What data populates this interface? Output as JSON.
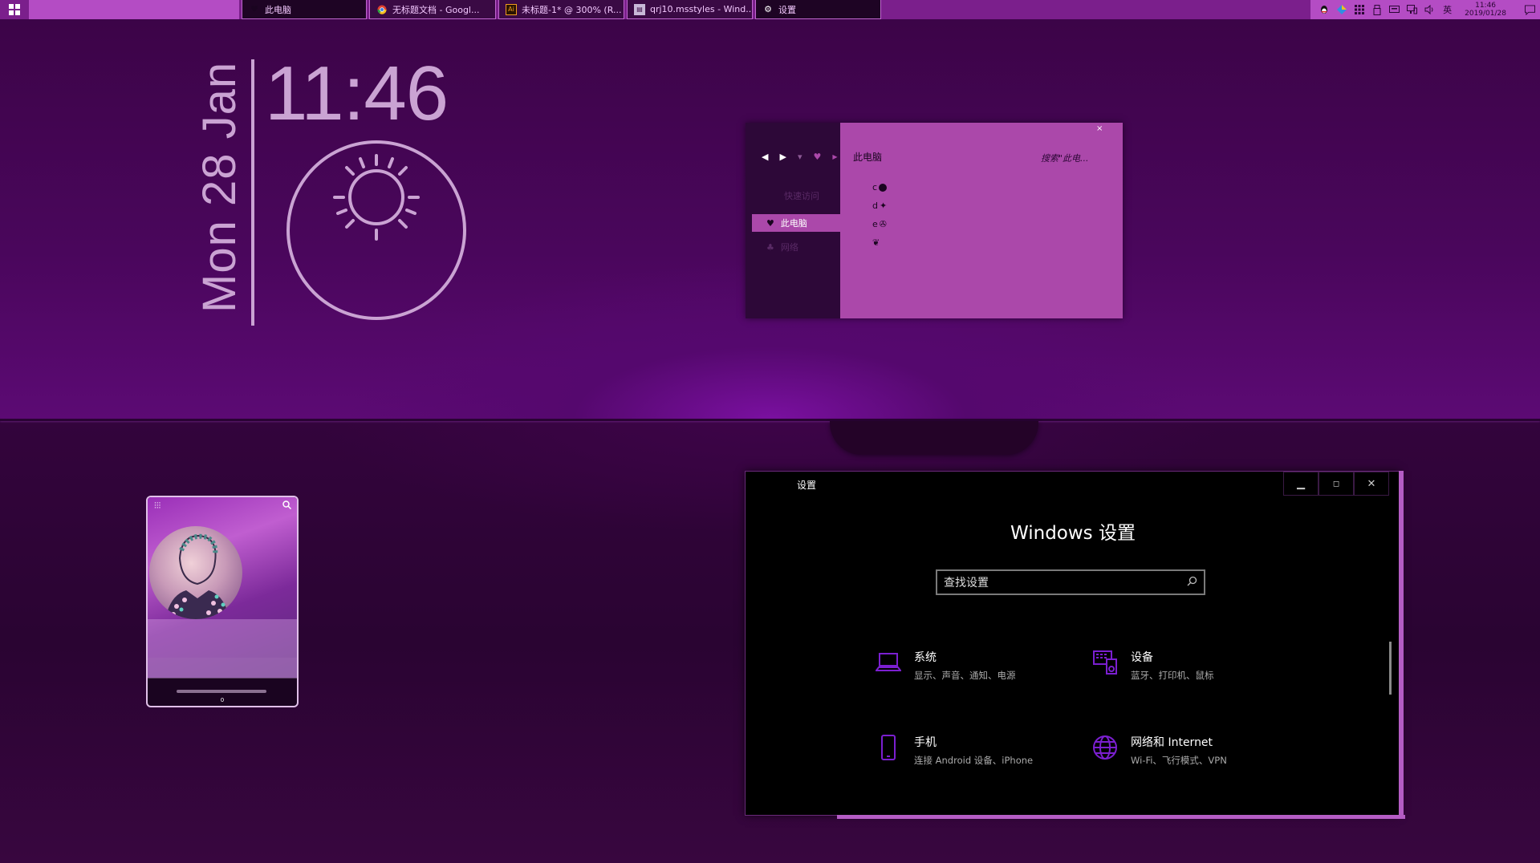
{
  "taskbar": {
    "tasks": [
      {
        "label": "此电脑",
        "icon": "heart-icon"
      },
      {
        "label": "无标题文档 - Googl...",
        "icon": "chrome-icon"
      },
      {
        "label": "未标题-1* @ 300% (R...",
        "icon": "illustrator-icon"
      },
      {
        "label": "qrj10.msstyles - Wind...",
        "icon": "file-icon"
      },
      {
        "label": "设置",
        "icon": "gear-icon"
      }
    ],
    "ime": "英",
    "time": "11:46",
    "date": "2019/01/28"
  },
  "clock_widget": {
    "date": "Mon 28 Jan",
    "time": "11:46",
    "weather_icon": "sun-icon"
  },
  "explorer": {
    "path": "此电脑",
    "search_placeholder": "搜索\"此电...",
    "close": "×",
    "sidebar": [
      "快速访问",
      "此电脑",
      "网络"
    ],
    "drives": [
      "c",
      "d",
      "e",
      ""
    ]
  },
  "music_widget": {
    "count": "0"
  },
  "settings": {
    "window_title": "设置",
    "heading": "Windows 设置",
    "search_placeholder": "查找设置",
    "categories": [
      {
        "title": "系统",
        "desc": "显示、声音、通知、电源",
        "icon": "laptop-icon"
      },
      {
        "title": "设备",
        "desc": "蓝牙、打印机、鼠标",
        "icon": "devices-icon"
      },
      {
        "title": "手机",
        "desc": "连接 Android 设备、iPhone",
        "icon": "phone-icon"
      },
      {
        "title": "网络和 Internet",
        "desc": "Wi-Fi、飞行模式、VPN",
        "icon": "globe-icon"
      }
    ],
    "accent": "#7b1fd0"
  },
  "colors": {
    "taskbar": "#7b1f8c",
    "widget_text": "#caa3d3",
    "explorer_bg": "#ab48aa"
  }
}
